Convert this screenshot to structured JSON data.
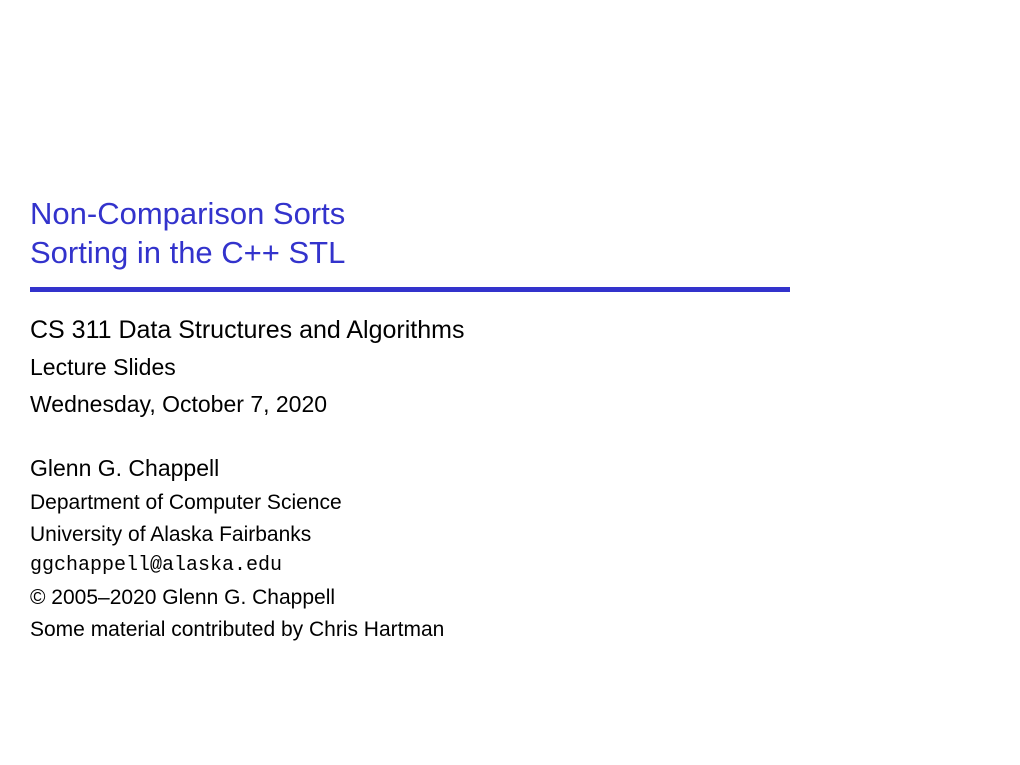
{
  "header": {
    "title_line1": "Non-Comparison Sorts",
    "title_line2": "Sorting in the C++ STL"
  },
  "body": {
    "course": "CS 311 Data Structures and Algorithms",
    "subtitle": "Lecture Slides",
    "date": "Wednesday, October 7, 2020",
    "author": "Glenn G. Chappell",
    "department": "Department of Computer Science",
    "university": "University of Alaska Fairbanks",
    "email": "ggchappell@alaska.edu",
    "copyright": "© 2005–2020 Glenn G. Chappell",
    "contributor": "Some material contributed by Chris Hartman"
  }
}
